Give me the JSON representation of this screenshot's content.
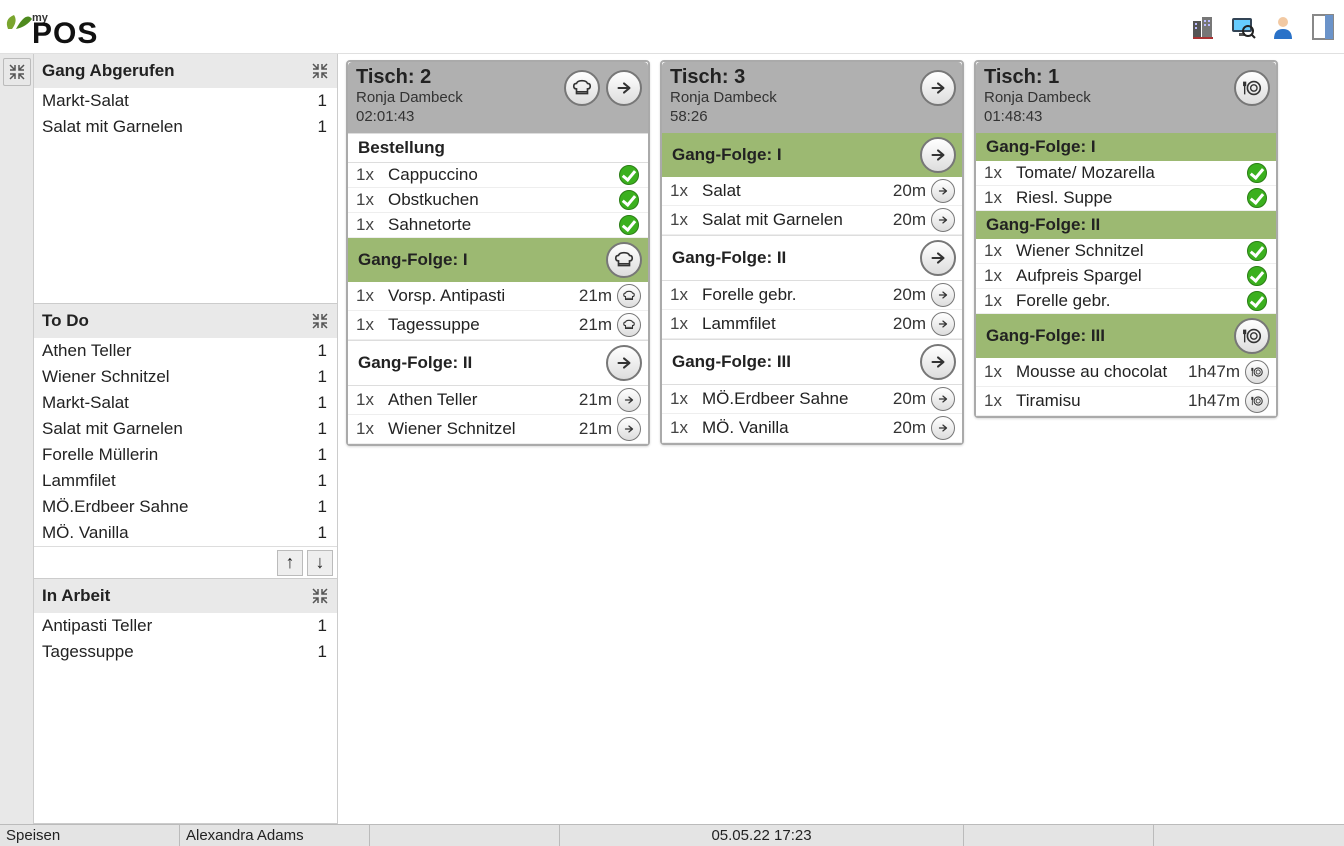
{
  "logo_my": "my",
  "logo_pos": "POS",
  "sidebar": {
    "gang_abgerufen": {
      "title": "Gang Abgerufen",
      "items": [
        {
          "name": "Markt-Salat",
          "count": "1"
        },
        {
          "name": "Salat mit Garnelen",
          "count": "1"
        }
      ]
    },
    "todo": {
      "title": "To Do",
      "items": [
        {
          "name": "Athen Teller",
          "count": "1"
        },
        {
          "name": "Wiener Schnitzel",
          "count": "1"
        },
        {
          "name": "Markt-Salat",
          "count": "1"
        },
        {
          "name": "Salat mit Garnelen",
          "count": "1"
        },
        {
          "name": "Forelle Müllerin",
          "count": "1"
        },
        {
          "name": "Lammfilet",
          "count": "1"
        },
        {
          "name": "MÖ.Erdbeer Sahne",
          "count": "1"
        },
        {
          "name": "MÖ. Vanilla",
          "count": "1"
        }
      ]
    },
    "in_arbeit": {
      "title": "In Arbeit",
      "items": [
        {
          "name": "Antipasti Teller",
          "count": "1"
        },
        {
          "name": "Tagessuppe",
          "count": "1"
        }
      ]
    }
  },
  "tables": [
    {
      "title": "Tisch: 2",
      "waiter": "Ronja Dambeck",
      "elapsed": "02:01:43",
      "header_icons": [
        "chef",
        "arrow"
      ],
      "sections": [
        {
          "type": "white",
          "label": "Bestellung",
          "icon": null,
          "lines": [
            {
              "qty": "1x",
              "name": "Cappuccino",
              "time": "",
              "icon": "check"
            },
            {
              "qty": "1x",
              "name": "Obstkuchen",
              "time": "",
              "icon": "check"
            },
            {
              "qty": "1x",
              "name": "Sahnetorte",
              "time": "",
              "icon": "check"
            }
          ]
        },
        {
          "type": "green",
          "label": "Gang-Folge: I",
          "icon": "chef-big",
          "lines": [
            {
              "qty": "1x",
              "name": "Vorsp. Antipasti",
              "time": "21m",
              "icon": "chef-sm"
            },
            {
              "qty": "1x",
              "name": "Tagessuppe",
              "time": "21m",
              "icon": "chef-sm"
            }
          ]
        },
        {
          "type": "white",
          "label": "Gang-Folge: II",
          "icon": "arrow-big",
          "lines": [
            {
              "qty": "1x",
              "name": "Athen Teller",
              "time": "21m",
              "icon": "arrow-sm"
            },
            {
              "qty": "1x",
              "name": "Wiener Schnitzel",
              "time": "21m",
              "icon": "arrow-sm"
            }
          ]
        }
      ]
    },
    {
      "title": "Tisch: 3",
      "waiter": "Ronja Dambeck",
      "elapsed": "58:26",
      "header_icons": [
        "arrow"
      ],
      "sections": [
        {
          "type": "green",
          "label": "Gang-Folge: I",
          "icon": "arrow-big",
          "lines": [
            {
              "qty": "1x",
              "name": "Salat",
              "time": "20m",
              "icon": "arrow-sm"
            },
            {
              "qty": "1x",
              "name": "Salat mit Garnelen",
              "time": "20m",
              "icon": "arrow-sm"
            }
          ]
        },
        {
          "type": "white",
          "label": "Gang-Folge: II",
          "icon": "arrow-big",
          "lines": [
            {
              "qty": "1x",
              "name": "Forelle gebr.",
              "time": "20m",
              "icon": "arrow-sm"
            },
            {
              "qty": "1x",
              "name": "Lammfilet",
              "time": "20m",
              "icon": "arrow-sm"
            }
          ]
        },
        {
          "type": "white",
          "label": "Gang-Folge: III",
          "icon": "arrow-big",
          "lines": [
            {
              "qty": "1x",
              "name": "MÖ.Erdbeer Sahne",
              "time": "20m",
              "icon": "arrow-sm"
            },
            {
              "qty": "1x",
              "name": "MÖ. Vanilla",
              "time": "20m",
              "icon": "arrow-sm"
            }
          ]
        }
      ]
    },
    {
      "title": "Tisch: 1",
      "waiter": "Ronja Dambeck",
      "elapsed": "01:48:43",
      "header_icons": [
        "plate"
      ],
      "sections": [
        {
          "type": "green",
          "label": "Gang-Folge: I",
          "icon": null,
          "lines": [
            {
              "qty": "1x",
              "name": "Tomate/ Mozarella",
              "time": "",
              "icon": "check"
            },
            {
              "qty": "1x",
              "name": "Riesl. Suppe",
              "time": "",
              "icon": "check"
            }
          ]
        },
        {
          "type": "green",
          "label": "Gang-Folge: II",
          "icon": null,
          "lines": [
            {
              "qty": "1x",
              "name": "Wiener Schnitzel",
              "time": "",
              "icon": "check"
            },
            {
              "qty": "1x",
              "name": "Aufpreis Spargel",
              "time": "",
              "icon": "check"
            },
            {
              "qty": "1x",
              "name": "Forelle gebr.",
              "time": "",
              "icon": "check"
            }
          ]
        },
        {
          "type": "green",
          "label": "Gang-Folge: III",
          "icon": "plate-big",
          "lines": [
            {
              "qty": "1x",
              "name": "Mousse au chocolat",
              "time": "1h47m",
              "icon": "plate-sm"
            },
            {
              "qty": "1x",
              "name": "Tiramisu",
              "time": "1h47m",
              "icon": "plate-sm"
            }
          ]
        }
      ]
    }
  ],
  "footer": {
    "mode": "Speisen",
    "user": "Alexandra Adams",
    "datetime": "05.05.22  17:23"
  }
}
